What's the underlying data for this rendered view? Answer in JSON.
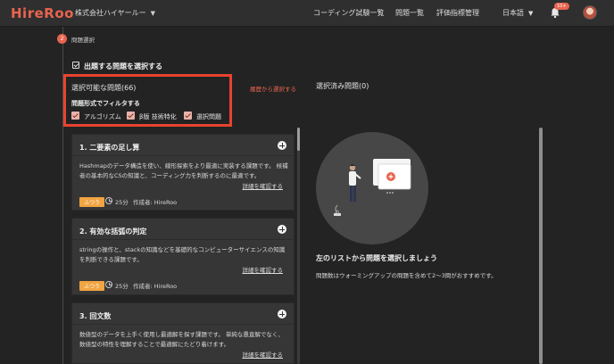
{
  "header": {
    "logo": "HireRoo",
    "company": "株式会社ハイヤールー",
    "nav": [
      "コーディング試験一覧",
      "問題一覧",
      "評価指標管理"
    ],
    "language": "日本語",
    "notification_badge": "10+"
  },
  "step": {
    "number": "2",
    "label": "問題選択"
  },
  "section": {
    "title": "出題する問題を選択する",
    "available_label": "選択可能な問題(66)",
    "history_link": "履歴から選択する",
    "selected_label": "選択済み問題(0)",
    "filter_title": "問題形式でフィルタする",
    "filters": [
      {
        "label": "アルゴリズム",
        "checked": true
      },
      {
        "label": "β版 技術特化",
        "checked": true
      },
      {
        "label": "選択問題",
        "checked": true
      }
    ]
  },
  "questions": [
    {
      "title": "1. 二要素の足し算",
      "description": "Hashmapのデータ構造を使い、線形探索をより最適に実装する課題です。 候補者の基本的なCSの知識と、コーディング力を判断するのに最適です。",
      "detail_link": "詳細を確認する",
      "difficulty": "ふつう",
      "time": "25分",
      "author": "作成者: HireRoo"
    },
    {
      "title": "2. 有効な括弧の判定",
      "description": "stringの操作と、stackの知識などを基礎的なコンピューターサイエンスの知識を判断できる課題です。",
      "detail_link": "詳細を確認する",
      "difficulty": "ふつう",
      "time": "25分",
      "author": "作成者: HireRoo"
    },
    {
      "title": "3. 回文数",
      "description": "数値型のデータを上手く使用し最適解を探す課題です。 単純な愚直解でなく、数値型の特性を理解することで最適解にたどり着けます。",
      "detail_link": "詳細を確認する"
    }
  ],
  "empty_state": {
    "title": "左のリストから問題を選択しましょう",
    "description": "問題数はウォーミングアップの問題を含めて2〜3問がおすすめです。"
  },
  "colors": {
    "accent": "#e9644f",
    "highlight_border": "#e8432f",
    "difficulty_badge": "#f0a442"
  }
}
